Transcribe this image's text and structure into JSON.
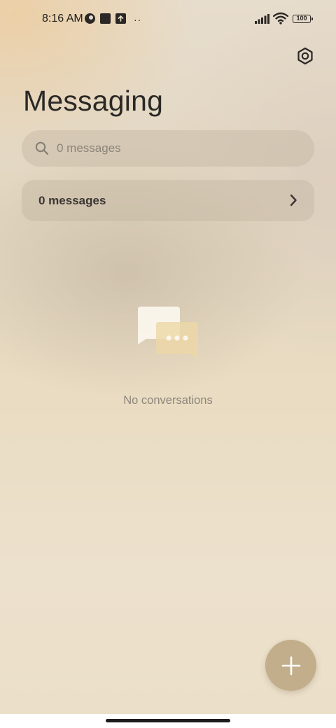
{
  "status_bar": {
    "time": "8:16 AM",
    "dots": "··",
    "battery": "100",
    "icons": [
      "app-notification-icon",
      "stop-square-icon",
      "upload-icon",
      "signal-icon",
      "wifi-icon",
      "battery-icon"
    ]
  },
  "header": {
    "title": "Messaging",
    "settings_icon": "settings-hexagon-icon"
  },
  "search": {
    "placeholder": "0 messages",
    "value": "",
    "icon": "search-icon"
  },
  "messages_row": {
    "label": "0 messages",
    "icon": "chevron-right-icon"
  },
  "empty_state": {
    "icon": "chat-bubbles-icon",
    "text": "No conversations"
  },
  "fab": {
    "icon": "plus-icon"
  },
  "colors": {
    "fab": "#c3ae8c",
    "card": "#d8cbb6",
    "accent_bubble": "#ecd7a6"
  }
}
